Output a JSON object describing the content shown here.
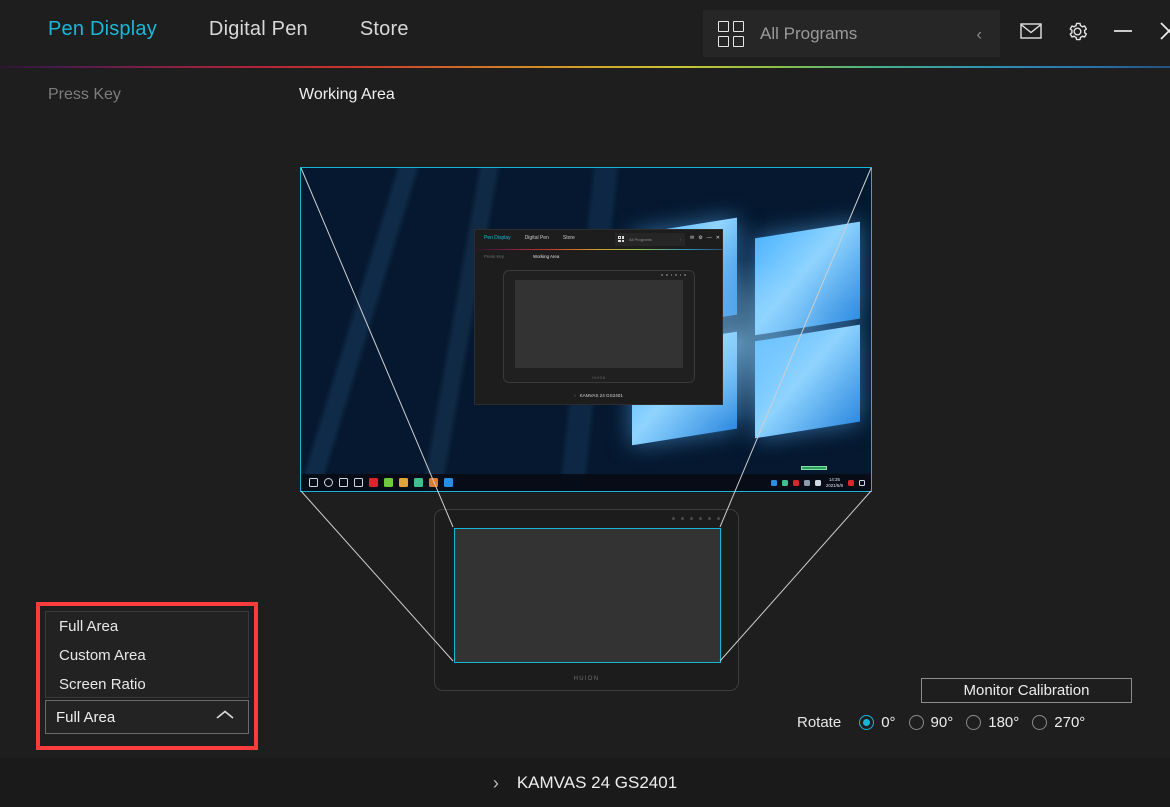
{
  "window": {
    "nav_tabs": [
      {
        "label": "Pen Display",
        "active": true
      },
      {
        "label": "Digital Pen",
        "active": false
      },
      {
        "label": "Store",
        "active": false
      }
    ],
    "all_programs": {
      "label": "All Programs",
      "grid_icon": "grid-icon",
      "collapse_icon": "chevron-left-icon"
    },
    "window_buttons": [
      {
        "name": "mail-icon",
        "label": ""
      },
      {
        "name": "settings-gear-icon",
        "label": ""
      },
      {
        "name": "minimize-icon",
        "label": ""
      },
      {
        "name": "close-icon",
        "label": ""
      }
    ],
    "accent_color": "#19b8d8",
    "background_color": "#1e1e1e"
  },
  "subtabs": [
    {
      "label": "Press Key",
      "active": false
    },
    {
      "label": "Working Area",
      "active": true
    }
  ],
  "preview": {
    "monitor": {
      "border_color": "#18b6d6",
      "inner_window": {
        "nav_tabs": [
          {
            "label": "Pen Display",
            "active": true
          },
          {
            "label": "Digital Pen",
            "active": false
          },
          {
            "label": "Store",
            "active": false
          }
        ],
        "all_programs": "All Programs",
        "subtabs": [
          {
            "label": "Press Key",
            "active": false
          },
          {
            "label": "Working Area",
            "active": true
          }
        ],
        "tablet_logo": "HUION",
        "bottom_device": "KAMVAS 24 GS2401",
        "bottom_chevron": "chevron-right-icon"
      },
      "taskbar": {
        "clock_time": "14:35",
        "clock_date": "2021/5/8"
      }
    },
    "tablet": {
      "logo": "HUION",
      "area_border_color": "#18b6d6"
    }
  },
  "area_dropdown": {
    "highlight_color": "#fb3c3c",
    "options": [
      {
        "label": "Full Area"
      },
      {
        "label": "Custom Area"
      },
      {
        "label": "Screen Ratio"
      }
    ],
    "selected": "Full Area",
    "caret_icon": "chevron-up-icon",
    "expanded": true
  },
  "controls": {
    "monitor_calibration_label": "Monitor Calibration",
    "rotate_label": "Rotate",
    "rotate_options": [
      {
        "label": "0°",
        "selected": true
      },
      {
        "label": "90°",
        "selected": false
      },
      {
        "label": "180°",
        "selected": false
      },
      {
        "label": "270°",
        "selected": false
      }
    ]
  },
  "footer": {
    "chevron": "›",
    "device_name": "KAMVAS 24 GS2401"
  }
}
